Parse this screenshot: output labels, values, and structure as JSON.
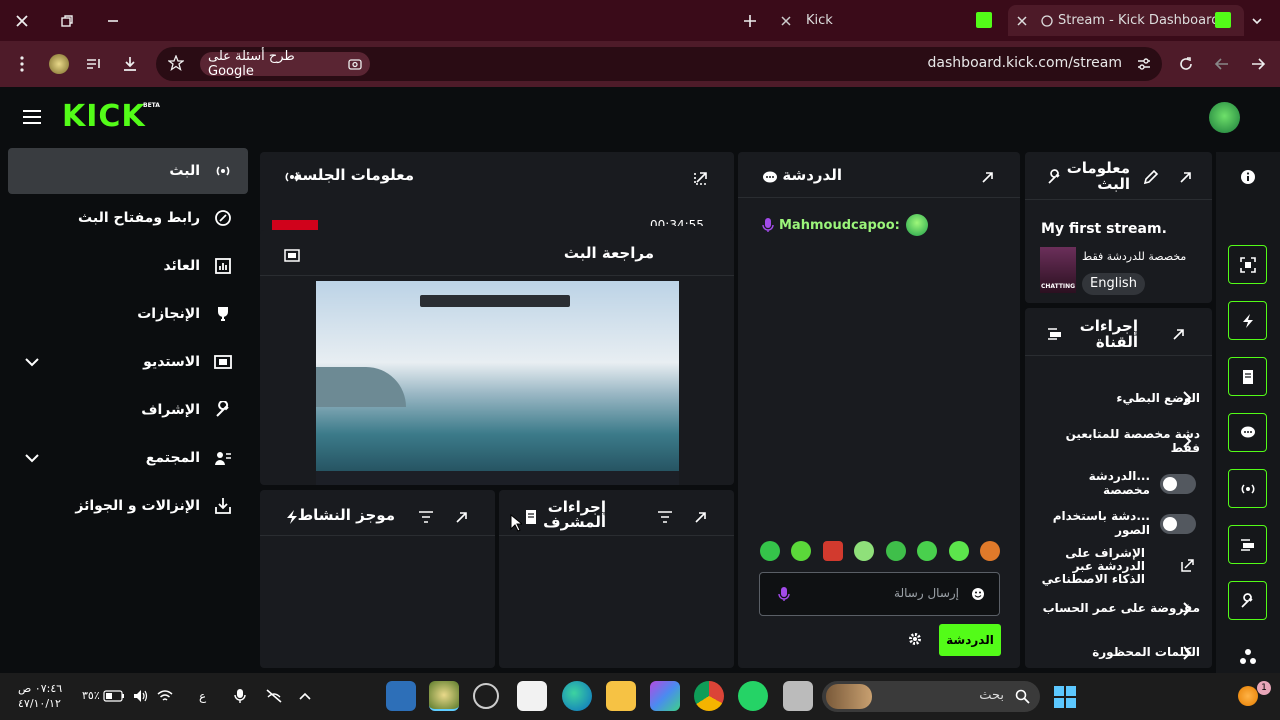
{
  "browser": {
    "tabs": [
      {
        "title": "Stream - Kick Dashboard",
        "active": true
      },
      {
        "title": "Kick",
        "active": false
      }
    ],
    "url": "dashboard.kick.com/stream",
    "ask_google": "طرح أسئلة على Google"
  },
  "header": {
    "logo": "KICK",
    "beta": "BETA"
  },
  "sidebar": {
    "items": [
      {
        "label": "البث",
        "active": true,
        "icon": "broadcast-icon"
      },
      {
        "label": "رابط ومفتاح البث",
        "icon": "key-link-icon"
      },
      {
        "label": "العائد",
        "icon": "chart-icon"
      },
      {
        "label": "الإنجازات",
        "icon": "trophy-icon"
      },
      {
        "label": "الاستديو",
        "icon": "studio-icon",
        "expandable": true
      },
      {
        "label": "الإشراف",
        "icon": "wrench-icon"
      },
      {
        "label": "المجتمع",
        "icon": "community-icon",
        "expandable": true
      },
      {
        "label": "الإنزالات و الجوائز",
        "icon": "drops-icon"
      }
    ]
  },
  "panels": {
    "session_info": {
      "title": "معلومات الجلسة",
      "partial_value": "00:34:55"
    },
    "stream_preview": {
      "title": "مراجعة البث"
    },
    "activity_feed": {
      "title": "موجز النشاط"
    },
    "mod_actions": {
      "title": "إجراءات المشرف"
    },
    "chat": {
      "title": "الدردشة",
      "messages": [
        {
          "user": "Mahmoudcapoo:"
        }
      ],
      "input_placeholder": "إرسال رسالة",
      "send_label": "الدردشة",
      "emotes": [
        "emote-1",
        "emote-2",
        "emote-3",
        "emote-4",
        "emote-5",
        "emote-6",
        "emote-7",
        "emote-8"
      ]
    },
    "stream_info": {
      "title": "معلومات البث",
      "stream_title": "My first stream.",
      "category": "مخصصة للدردشة فقط",
      "category_thumb": "CHATTING",
      "language": "English"
    },
    "channel_actions": {
      "title": "إجراءات القناة",
      "items": [
        {
          "label": "الوضع البطيء",
          "type": "chevron"
        },
        {
          "label": "دشة مخصصة للمتابعين فقط",
          "type": "chevron"
        },
        {
          "label": "...الدردشة مخصصة",
          "type": "toggle",
          "on": false
        },
        {
          "label": "...دشة باستخدام الصور",
          "type": "toggle",
          "on": false
        },
        {
          "label": "الإشراف على الدردشة عبر الذكاء الاصطناعي",
          "type": "external"
        },
        {
          "label": "مفروضة على عمر الحساب",
          "type": "chevron"
        },
        {
          "label": "الكلمات المحظورة",
          "type": "chevron"
        }
      ]
    }
  },
  "taskbar": {
    "search_placeholder": "بحث",
    "time": "٠٧:٤٦ ص",
    "date": "٤٧/١٠/١٢",
    "battery": "٣٥٪",
    "lang": "ع",
    "notification_count": "1"
  },
  "colors": {
    "accent": "#53fc18",
    "panel": "#191b1f",
    "bg": "#0b0d0f"
  }
}
